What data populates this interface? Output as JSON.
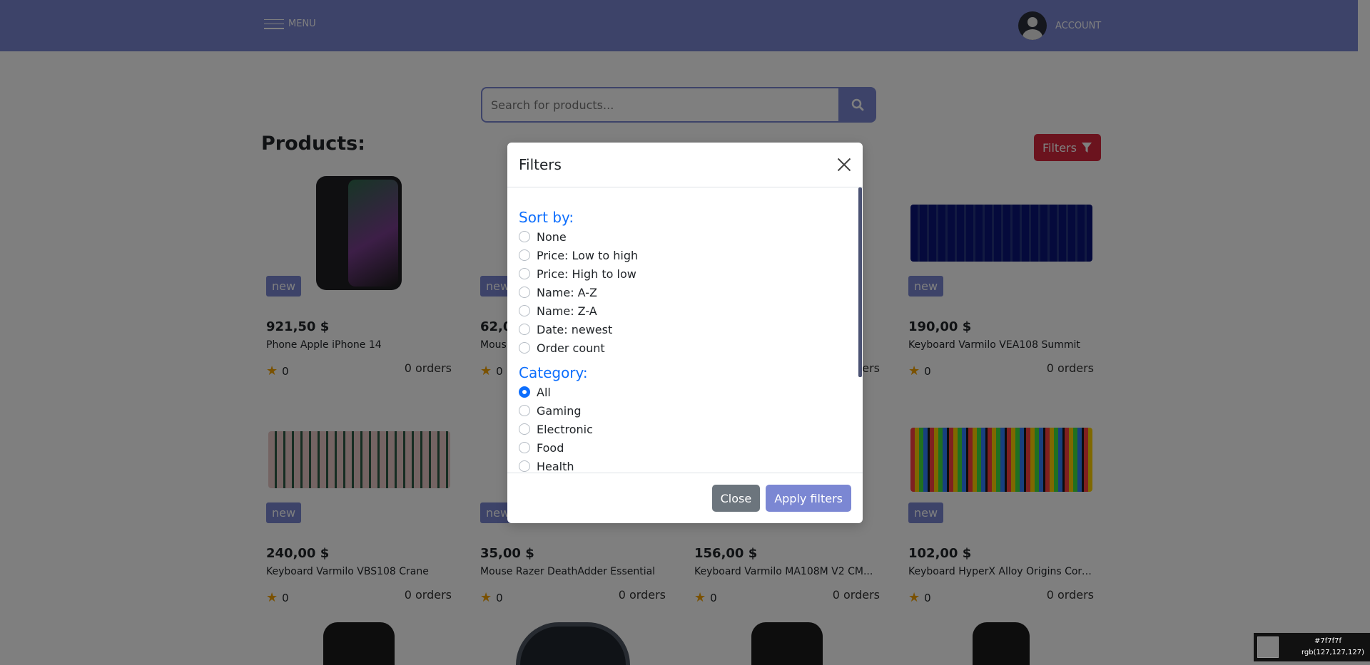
{
  "navbar": {
    "menu_label": "MENU",
    "account_label": "ACCOUNT"
  },
  "search": {
    "placeholder": "Search for products..."
  },
  "page": {
    "title": "Products:",
    "filters_label": "Filters"
  },
  "products": [
    {
      "price": "921,50 $",
      "name": "Phone Apple iPhone 14",
      "badge": "new",
      "rating": "0",
      "orders": "0 orders"
    },
    {
      "price": "62,0",
      "name": "Mous",
      "badge": "new",
      "rating": "0",
      "orders": ""
    },
    {
      "price": "",
      "name": "",
      "badge": "",
      "rating": "",
      "orders": "ers"
    },
    {
      "price": "190,00 $",
      "name": "Keyboard Varmilo VEA108 Summit",
      "badge": "new",
      "rating": "0",
      "orders": "0 orders"
    },
    {
      "price": "240,00 $",
      "name": "Keyboard Varmilo VBS108 Crane",
      "badge": "new",
      "rating": "0",
      "orders": "0 orders"
    },
    {
      "price": "35,00 $",
      "name": "Mouse Razer DeathAdder Essential",
      "badge": "new",
      "rating": "0",
      "orders": "0 orders"
    },
    {
      "price": "156,00 $",
      "name": "Keyboard Varmilo MA108M V2 CM...",
      "badge": "new",
      "rating": "0",
      "orders": "0 orders"
    },
    {
      "price": "102,00 $",
      "name": "Keyboard HyperX Alloy Origins Core...",
      "badge": "new",
      "rating": "0",
      "orders": "0 orders"
    }
  ],
  "modal": {
    "title": "Filters",
    "sort_title": "Sort by:",
    "sort_options": [
      "None",
      "Price: Low to high",
      "Price: High to low",
      "Name: A-Z",
      "Name: Z-A",
      "Date: newest",
      "Order count"
    ],
    "category_title": "Category:",
    "category_options": [
      "All",
      "Gaming",
      "Electronic",
      "Food",
      "Health"
    ],
    "category_selected": "All",
    "close_label": "Close",
    "apply_label": "Apply filters"
  },
  "picker": {
    "hex": "#7f7f7f",
    "rgb": "rgb(127,127,127)"
  }
}
